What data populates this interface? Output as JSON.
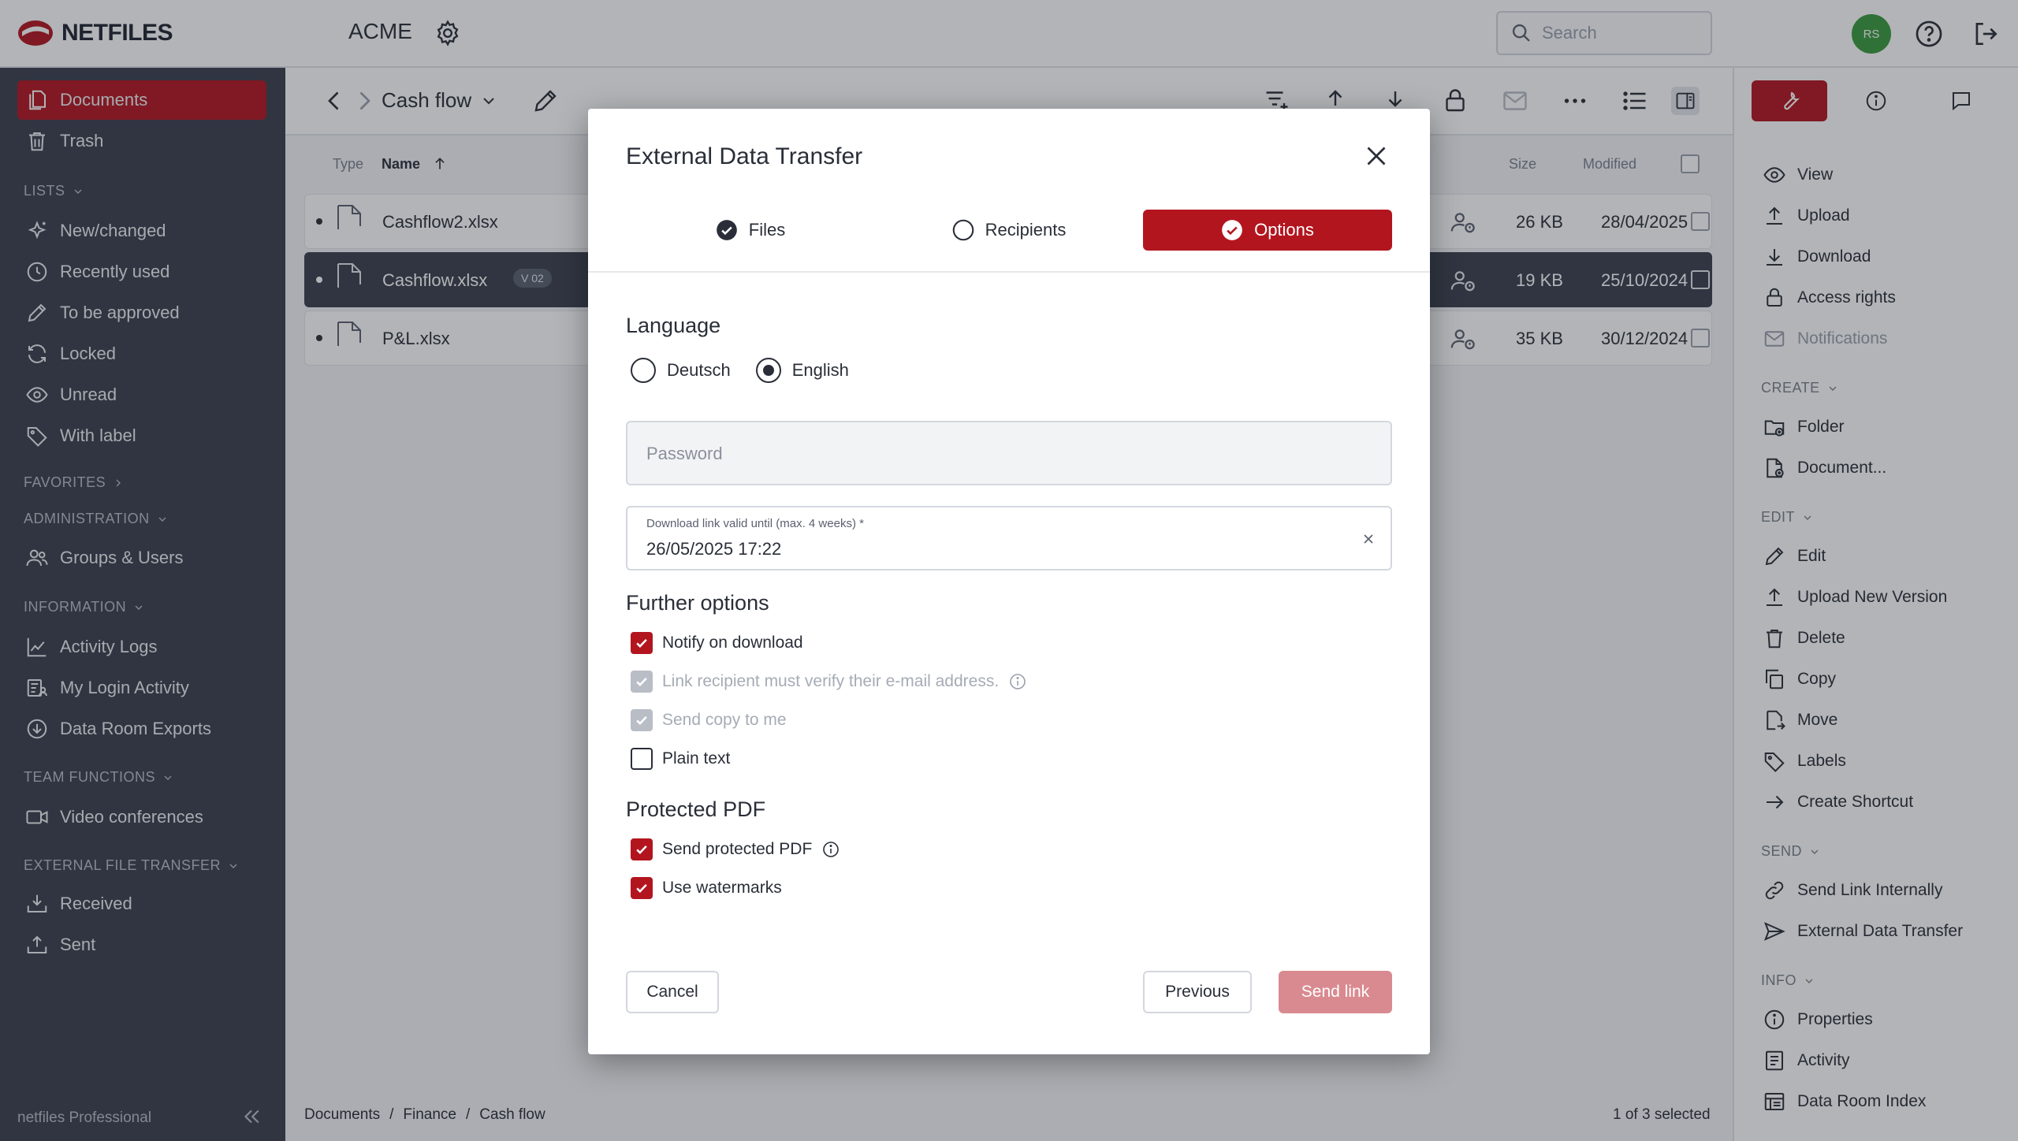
{
  "header": {
    "brand": "NETFILES",
    "workspace": "ACME",
    "search_placeholder": "Search",
    "avatar_initials": "RS"
  },
  "sidebar": {
    "items_top": [
      {
        "label": "Documents",
        "icon": "documents-icon",
        "active": true
      },
      {
        "label": "Trash",
        "icon": "trash-icon"
      }
    ],
    "lists_head": "LISTS",
    "lists": [
      {
        "label": "New/changed",
        "icon": "sparkle-icon"
      },
      {
        "label": "Recently used",
        "icon": "clock-icon"
      },
      {
        "label": "To be approved",
        "icon": "pencil-icon"
      },
      {
        "label": "Locked",
        "icon": "sync-icon"
      },
      {
        "label": "Unread",
        "icon": "eye-icon"
      },
      {
        "label": "With label",
        "icon": "tag-icon"
      }
    ],
    "favorites_head": "FAVORITES",
    "admin_head": "ADMINISTRATION",
    "admin": [
      {
        "label": "Groups & Users",
        "icon": "users-icon"
      }
    ],
    "info_head": "INFORMATION",
    "info": [
      {
        "label": "Activity Logs",
        "icon": "chart-icon"
      },
      {
        "label": "My Login Activity",
        "icon": "list-user-icon"
      },
      {
        "label": "Data Room Exports",
        "icon": "download-circle-icon"
      }
    ],
    "team_head": "TEAM FUNCTIONS",
    "team": [
      {
        "label": "Video conferences",
        "icon": "video-icon"
      }
    ],
    "eft_head": "EXTERNAL FILE TRANSFER",
    "eft": [
      {
        "label": "Received",
        "icon": "inbox-icon"
      },
      {
        "label": "Sent",
        "icon": "outbox-icon"
      }
    ],
    "footer": "netfiles Professional"
  },
  "main": {
    "folder_title": "Cash flow",
    "columns": {
      "type": "Type",
      "name": "Name",
      "size": "Size",
      "modified": "Modified"
    },
    "files": [
      {
        "name": "Cashflow2.xlsx",
        "ext": "XLS",
        "size": "26 KB",
        "modified": "28/04/2025",
        "selected": false,
        "badge": ""
      },
      {
        "name": "Cashflow.xlsx",
        "ext": "XLS",
        "size": "19 KB",
        "modified": "25/10/2024",
        "selected": true,
        "badge": "V 02"
      },
      {
        "name": "P&L.xlsx",
        "ext": "XLS",
        "size": "35 KB",
        "modified": "30/12/2024",
        "selected": false,
        "badge": ""
      }
    ],
    "breadcrumb": [
      "Documents",
      "Finance",
      "Cash flow"
    ],
    "breadcrumb_sep": "/",
    "selection_count": "1 of 3 selected"
  },
  "rpanel": {
    "actions": [
      {
        "label": "View",
        "icon": "eye-icon"
      },
      {
        "label": "Upload",
        "icon": "upload-icon"
      },
      {
        "label": "Download",
        "icon": "download-icon"
      },
      {
        "label": "Access rights",
        "icon": "lock-icon"
      },
      {
        "label": "Notifications",
        "icon": "mail-icon",
        "disabled": true
      }
    ],
    "create_head": "CREATE",
    "create": [
      {
        "label": "Folder",
        "icon": "folder-plus-icon"
      },
      {
        "label": "Document...",
        "icon": "document-plus-icon"
      }
    ],
    "edit_head": "EDIT",
    "edit": [
      {
        "label": "Edit",
        "icon": "pencil-icon"
      },
      {
        "label": "Upload New Version",
        "icon": "upload-icon"
      },
      {
        "label": "Delete",
        "icon": "trash-icon"
      },
      {
        "label": "Copy",
        "icon": "copy-icon"
      },
      {
        "label": "Move",
        "icon": "move-icon"
      },
      {
        "label": "Labels",
        "icon": "tag-icon"
      },
      {
        "label": "Create Shortcut",
        "icon": "arrow-right-icon"
      }
    ],
    "send_head": "SEND",
    "send": [
      {
        "label": "Send Link Internally",
        "icon": "link-icon"
      },
      {
        "label": "External Data Transfer",
        "icon": "send-icon"
      }
    ],
    "info_head": "INFO",
    "info": [
      {
        "label": "Properties",
        "icon": "info-icon"
      },
      {
        "label": "Activity",
        "icon": "list-icon"
      },
      {
        "label": "Data Room Index",
        "icon": "index-icon"
      }
    ]
  },
  "modal": {
    "title": "External Data Transfer",
    "steps": [
      {
        "label": "Files",
        "state": "done"
      },
      {
        "label": "Recipients",
        "state": "todo"
      },
      {
        "label": "Options",
        "state": "active"
      }
    ],
    "language_title": "Language",
    "languages": [
      {
        "label": "Deutsch",
        "selected": false
      },
      {
        "label": "English",
        "selected": true
      }
    ],
    "password_placeholder": "Password",
    "valid_label": "Download link valid until (max. 4 weeks) *",
    "valid_value": "26/05/2025 17:22",
    "further_title": "Further options",
    "further": [
      {
        "label": "Notify on download",
        "checked": true,
        "disabled": false,
        "info": false
      },
      {
        "label": "Link recipient must verify their e-mail address.",
        "checked": true,
        "disabled": true,
        "info": true
      },
      {
        "label": "Send copy to me",
        "checked": true,
        "disabled": true,
        "info": false
      },
      {
        "label": "Plain text",
        "checked": false,
        "disabled": false,
        "info": false
      }
    ],
    "pdf_title": "Protected PDF",
    "pdf": [
      {
        "label": "Send protected PDF",
        "checked": true,
        "disabled": false,
        "info": true
      },
      {
        "label": "Use watermarks",
        "checked": true,
        "disabled": false,
        "info": false
      }
    ],
    "cancel": "Cancel",
    "previous": "Previous",
    "send": "Send link"
  },
  "colors": {
    "accent": "#b3151f",
    "sidebar": "#3a3f4c",
    "avatar": "#3b9a3f"
  }
}
